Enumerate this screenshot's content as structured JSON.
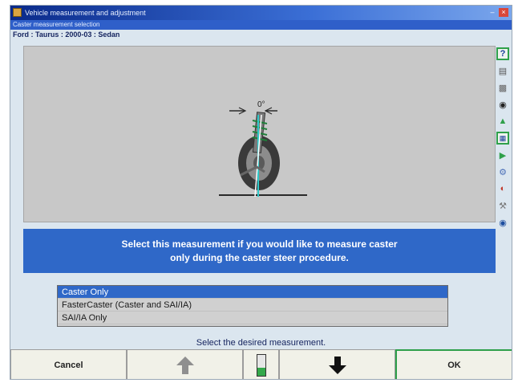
{
  "window": {
    "title": "Vehicle measurement and adjustment",
    "subtitle": "Caster measurement selection"
  },
  "vehicle": {
    "info": "Ford : Taurus : 2000-03 : Sedan"
  },
  "diagram": {
    "angle_label": "0°"
  },
  "info": {
    "line1": "Select this measurement if you would like to measure caster",
    "line2": "only during the caster steer procedure."
  },
  "list": {
    "items": [
      "Caster Only",
      "FasterCaster (Caster and SAI/IA)",
      "SAI/IA Only"
    ],
    "selected_index": 0
  },
  "prompt": "Select the desired measurement.",
  "buttons": {
    "cancel": "Cancel",
    "ok": "OK"
  },
  "progress": {
    "level": 0.35
  },
  "colors": {
    "accent": "#2f68c8",
    "highlight": "#2fa04a",
    "title_bar": "#0a2a8a"
  },
  "sidebar_icons": [
    "help-icon",
    "vehicle-specs-icon",
    "printer-icon",
    "tire-icon",
    "adjust-icon",
    "alignment-sequence-icon",
    "go-icon",
    "settings-icon",
    "gauge-icon",
    "tools-icon",
    "globe-icon"
  ]
}
